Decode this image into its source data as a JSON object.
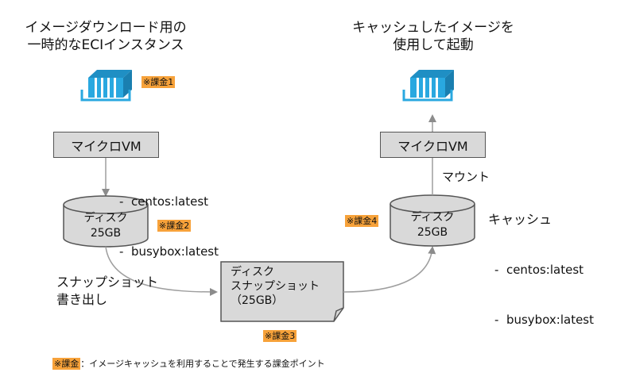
{
  "left": {
    "title_line1": "イメージダウンロード用の",
    "title_line2": "一時的なECIインスタンス",
    "billing1": "※課金1",
    "vm_label": "マイクロVM",
    "images": [
      "-  centos:latest",
      "-  busybox:latest"
    ],
    "disk_line1": "ディスク",
    "disk_line2": "25GB",
    "billing2": "※課金2"
  },
  "middle": {
    "snapshot_line1": "スナップショット",
    "snapshot_line2": "書き出し",
    "doc_line1": "ディスク",
    "doc_line2": "スナップショット",
    "doc_line3": "（25GB）",
    "billing3": "※課金3"
  },
  "right": {
    "title_line1": "キャッシュしたイメージを",
    "title_line2": "使用して起動",
    "vm_label": "マイクロVM",
    "mount_label": "マウント",
    "disk_line1": "ディスク",
    "disk_line2": "25GB",
    "billing4": "※課金4",
    "cache_title": "キャッシュ",
    "cache_items": [
      "-  centos:latest",
      "-  busybox:latest"
    ]
  },
  "footer": {
    "tag": "※課金",
    "text": "：イメージキャッシュを利用することで発生する課金ポイント"
  },
  "colors": {
    "container_icon": "#29a8e0",
    "billing_tag": "#f7a23a",
    "box_fill": "#d9d9d9",
    "line": "#9e9e9e"
  }
}
